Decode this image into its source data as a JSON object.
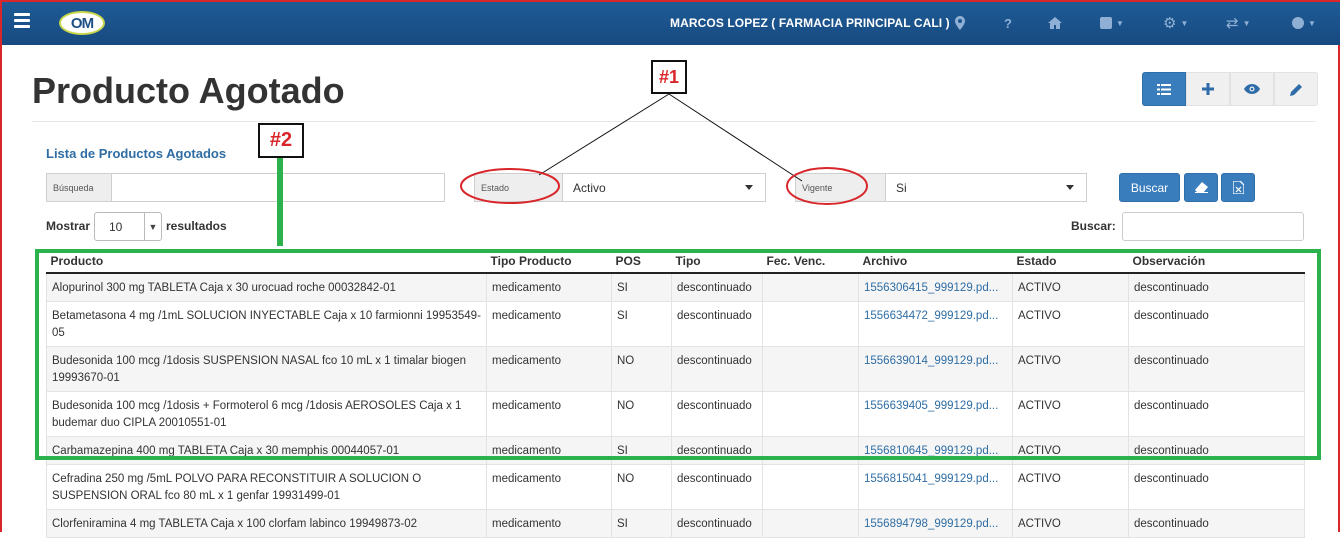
{
  "navbar": {
    "user_label": "MARCOS LOPEZ ( FARMACIA PRINCIPAL CALI )",
    "logo_text": "OM",
    "icons": [
      "map-marker-icon",
      "question-icon",
      "home-icon",
      "square-icon",
      "gear-icon",
      "refresh-icon",
      "circle-user-icon"
    ]
  },
  "page": {
    "title": "Producto Agotado",
    "list_heading": "Lista de Productos Agotados"
  },
  "filters": {
    "busqueda_label": "Búsqueda",
    "busqueda_value": "",
    "estado_label": "Estado",
    "estado_value": "Activo",
    "vigente_label": "Vigente",
    "vigente_value": "Si",
    "buscar_button": "Buscar"
  },
  "table_controls": {
    "show_label": "Mostrar",
    "show_value": "10",
    "show_suffix": "resultados",
    "search_label": "Buscar:",
    "search_value": ""
  },
  "table": {
    "columns": [
      "Producto",
      "Tipo Producto",
      "POS",
      "Tipo",
      "Fec. Venc.",
      "Archivo",
      "Estado",
      "Observación"
    ],
    "rows": [
      {
        "producto": "Alopurinol 300 mg TABLETA Caja x 30 urocuad roche 00032842-01",
        "tipo_producto": "medicamento",
        "pos": "SI",
        "tipo": "descontinuado",
        "fec_venc": "",
        "archivo": "1556306415_999129.pd...",
        "estado": "ACTIVO",
        "observacion": "descontinuado"
      },
      {
        "producto": "Betametasona 4 mg /1mL SOLUCION INYECTABLE Caja x 10 farmionni 19953549-05",
        "tipo_producto": "medicamento",
        "pos": "SI",
        "tipo": "descontinuado",
        "fec_venc": "",
        "archivo": "1556634472_999129.pd...",
        "estado": "ACTIVO",
        "observacion": "descontinuado"
      },
      {
        "producto": "Budesonida 100 mcg /1dosis SUSPENSION NASAL fco 10 mL x 1 timalar biogen 19993670-01",
        "tipo_producto": "medicamento",
        "pos": "NO",
        "tipo": "descontinuado",
        "fec_venc": "",
        "archivo": "1556639014_999129.pd...",
        "estado": "ACTIVO",
        "observacion": "descontinuado"
      },
      {
        "producto": "Budesonida 100 mcg /1dosis + Formoterol 6 mcg /1dosis AEROSOLES Caja x 1 budemar duo CIPLA 20010551-01",
        "tipo_producto": "medicamento",
        "pos": "NO",
        "tipo": "descontinuado",
        "fec_venc": "",
        "archivo": "1556639405_999129.pd...",
        "estado": "ACTIVO",
        "observacion": "descontinuado"
      },
      {
        "producto": "Carbamazepina 400 mg TABLETA Caja x 30 memphis 00044057-01",
        "tipo_producto": "medicamento",
        "pos": "SI",
        "tipo": "descontinuado",
        "fec_venc": "",
        "archivo": "1556810645_999129.pd...",
        "estado": "ACTIVO",
        "observacion": "descontinuado"
      },
      {
        "producto": "Cefradina 250 mg /5mL POLVO PARA RECONSTITUIR A SOLUCION O SUSPENSION ORAL fco 80 mL x 1 genfar 19931499-01",
        "tipo_producto": "medicamento",
        "pos": "NO",
        "tipo": "descontinuado",
        "fec_venc": "",
        "archivo": "1556815041_999129.pd...",
        "estado": "ACTIVO",
        "observacion": "descontinuado"
      },
      {
        "producto": "Clorfeniramina 4 mg TABLETA Caja x 100 clorfam labinco 19949873-02",
        "tipo_producto": "medicamento",
        "pos": "SI",
        "tipo": "descontinuado",
        "fec_venc": "",
        "archivo": "1556894798_999129.pd...",
        "estado": "ACTIVO",
        "observacion": "descontinuado"
      }
    ]
  },
  "annotations": {
    "label_1": "#1",
    "label_2": "#2",
    "color_red": "#d8262a",
    "color_green": "#2bb24c"
  },
  "colors": {
    "navbar": "#1f5b96",
    "primary_button": "#3a7dbd",
    "link": "#2f6da4"
  }
}
